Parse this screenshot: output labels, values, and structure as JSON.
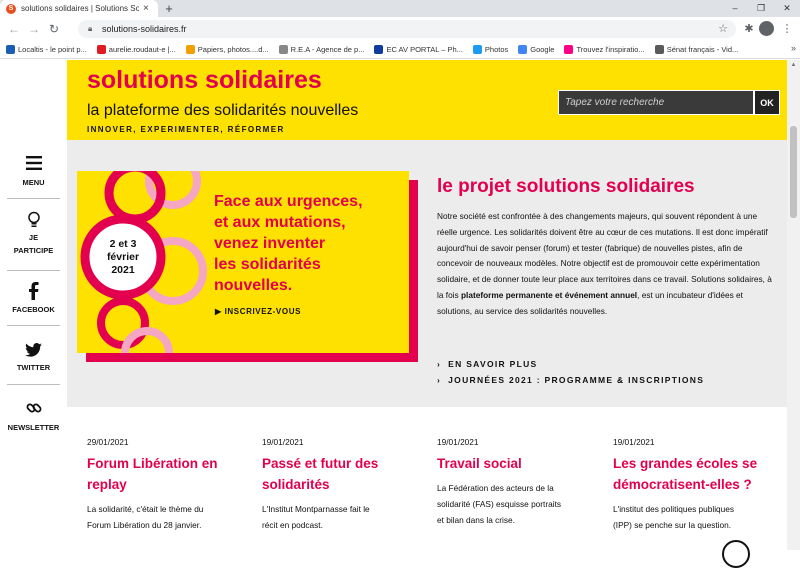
{
  "browser": {
    "tab_title": "solutions solidaires | Solutions So",
    "tab_close": "×",
    "new_tab": "+",
    "window_controls": [
      "–",
      "❐",
      "✕"
    ],
    "url": "solutions-solidaires.fr",
    "bookmarks": [
      {
        "label": "Localtis - le point p...",
        "icon": "localtis-icon",
        "color": "#1a5fb4"
      },
      {
        "label": "aurelie.roudaut-e |...",
        "icon": "outlook-icon",
        "color": "#e01b24"
      },
      {
        "label": "Papiers, photos....d...",
        "icon": "microsoft-icon",
        "color": "#f0a000"
      },
      {
        "label": "R.E.A - Agence de p...",
        "icon": "rea-icon",
        "color": "#888888"
      },
      {
        "label": "EC AV PORTAL – Ph...",
        "icon": "eu-icon",
        "color": "#0f3c9e"
      },
      {
        "label": "Photos",
        "icon": "twitter-icon",
        "color": "#1d9bf0"
      },
      {
        "label": "Google",
        "icon": "google-icon",
        "color": "#4285f4"
      },
      {
        "label": "Trouvez l'inspiratio...",
        "icon": "flickr-icon",
        "color": "#ff0084"
      },
      {
        "label": "Sénat français - Vid...",
        "icon": "senat-icon",
        "color": "#5a5a5a"
      }
    ],
    "bookmarks_more": "»"
  },
  "sidebar": {
    "items": [
      {
        "label": "MENU",
        "icon": "menu-icon"
      },
      {
        "label": "JE",
        "label2": "PARTICIPE",
        "icon": "lightbulb-icon"
      },
      {
        "label": "FACEBOOK",
        "icon": "facebook-icon"
      },
      {
        "label": "TWITTER",
        "icon": "twitter-icon"
      },
      {
        "label": "NEWSLETTER",
        "icon": "link-icon"
      }
    ]
  },
  "header": {
    "title": "solutions solidaires",
    "subtitle": "la plateforme des solidarités nouvelles",
    "tagline": "INNOVER, EXPERIMENTER, RÉFORMER",
    "search_placeholder": "Tapez votre recherche",
    "search_button": "OK"
  },
  "banner": {
    "lines": [
      "Face aux urgences,",
      "et aux mutations,",
      "venez inventer",
      "les solidarités",
      "nouvelles."
    ],
    "cta": "INSCRIVEZ-VOUS",
    "cta_arrow": "▶",
    "date_lines": [
      "2 et 3",
      "février",
      "2021"
    ]
  },
  "project": {
    "title": "le projet solutions solidaires",
    "body_1": "Notre société est confrontée à des changements majeurs, qui souvent répondent à une réelle urgence. Les solidarités doivent être au cœur de ces mutations. Il est donc impératif aujourd'hui de savoir penser (forum) et tester (fabrique) de nouvelles pistes, afin de concevoir de nouveaux modèles. Notre objectif est de promouvoir cette expérimentation solidaire, et de donner toute leur place aux territoires dans ce travail. Solutions solidaires, à la fois ",
    "body_bold": "plateforme permanente et événement annuel",
    "body_2": ", est un incubateur d'idées et solutions, au service des solidarités nouvelles.",
    "links": [
      "EN SAVOIR PLUS",
      "JOURNÉES 2021 : PROGRAMME & INSCRIPTIONS"
    ],
    "link_chevron": "›"
  },
  "news": [
    {
      "date": "29/01/2021",
      "title_lines": [
        "Forum Libération en",
        "replay"
      ],
      "excerpt_lines": [
        "La solidarité, c'était le thème du",
        "Forum Libération du 28 janvier."
      ]
    },
    {
      "date": "19/01/2021",
      "title_lines": [
        "Passé et futur des",
        "solidarités"
      ],
      "excerpt_lines": [
        "L'Institut Montparnasse fait le",
        "récit en podcast."
      ]
    },
    {
      "date": "19/01/2021",
      "title_lines": [
        "Travail social"
      ],
      "excerpt_lines": [
        "La Fédération des acteurs de la",
        "solidarité (FAS) esquisse portraits",
        "et bilan dans la crise."
      ]
    },
    {
      "date": "19/01/2021",
      "title_lines": [
        "Les grandes écoles se",
        "démocratisent-elles ?"
      ],
      "excerpt_lines": [
        "L'institut des politiques publiques",
        "(IPP) se penche sur la question."
      ]
    }
  ],
  "colors": {
    "accent": "#e3004f",
    "brand_yellow": "#ffe100",
    "background": "#ececec",
    "pink_ring": "#f4a6c2"
  }
}
